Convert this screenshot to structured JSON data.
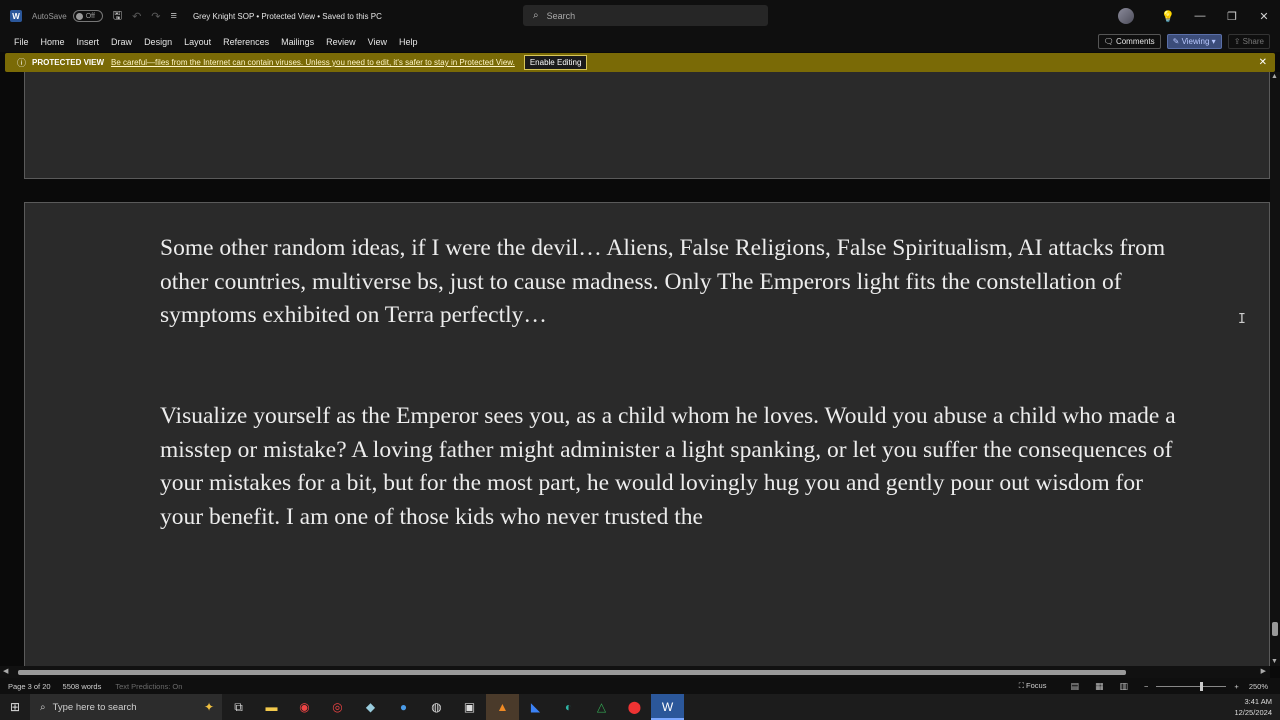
{
  "titlebar": {
    "app_icon_letter": "W",
    "autosave_label": "AutoSave",
    "autosave_state": "Off",
    "doc_title": "Grey Knight SOP  •  Protected View • Saved to this PC",
    "search_placeholder": "Search",
    "window_buttons": [
      "—",
      "❐",
      "✕"
    ]
  },
  "ribbon": {
    "tabs": [
      "File",
      "Home",
      "Insert",
      "Draw",
      "Design",
      "Layout",
      "References",
      "Mailings",
      "Review",
      "View",
      "Help"
    ],
    "comments_label": "Comments",
    "viewing_label": "Viewing",
    "share_label": "Share"
  },
  "banner": {
    "label": "PROTECTED VIEW",
    "message": "Be careful—files from the Internet can contain viruses. Unless you need to edit, it's safer to stay in Protected View.",
    "enable_label": "Enable Editing",
    "color": "#7a6a06"
  },
  "document": {
    "paragraphs": [
      "Some other random ideas, if I were the devil… Aliens, False Religions, False Spiritualism, AI attacks from other countries, multiverse bs, just to cause madness. Only The Emperors light fits the constellation of symptoms exhibited on Terra perfectly…",
      "Visualize yourself as the Emperor sees you, as a child whom he loves. Would you abuse a child who made a misstep or mistake? A loving father might administer a light spanking, or let you suffer the consequences of your mistakes for a bit, but for the most part, he would lovingly hug you and gently pour out wisdom for your benefit. I am one of those kids who never trusted the"
    ]
  },
  "statusbar": {
    "page": "Page 3 of 20",
    "words": "5508 words",
    "text_predictions": "Text Predictions: On",
    "focus_label": "Focus",
    "zoom": "250%"
  },
  "taskbar": {
    "search_placeholder": "Type here to search",
    "time": "3:41 AM",
    "date": "12/25/2024"
  }
}
